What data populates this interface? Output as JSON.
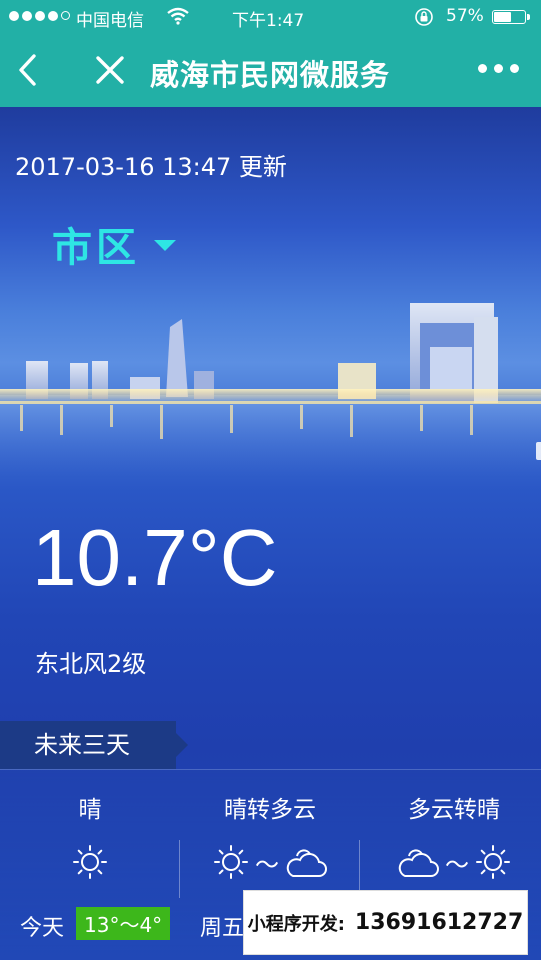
{
  "status_bar": {
    "carrier": "中国电信",
    "time": "下午1:47",
    "battery_percent": "57%",
    "battery_level": 0.57
  },
  "nav": {
    "title": "威海市民网微服务"
  },
  "weather": {
    "update_time": "2017-03-16 13:47 更新",
    "region": "市区",
    "temperature": "10.7°C",
    "wind": "东北风2级"
  },
  "forecast": {
    "tab_label": "未来三天",
    "days": [
      {
        "condition": "晴",
        "icons": [
          "sun-icon"
        ],
        "label": "今天",
        "temp_range": "13°～4°"
      },
      {
        "condition": "晴转多云",
        "icons": [
          "sun-icon",
          "cloud-icon"
        ],
        "label": "周五"
      },
      {
        "condition": "多云转晴",
        "icons": [
          "cloud-icon",
          "sun-icon"
        ]
      }
    ],
    "tilde": "～"
  },
  "promo": {
    "label": "小程序开发:",
    "phone": "13691612727"
  },
  "colors": {
    "header": "#22b0a6",
    "region_accent": "#2ee6e4",
    "temp_badge": "#3db71b"
  }
}
